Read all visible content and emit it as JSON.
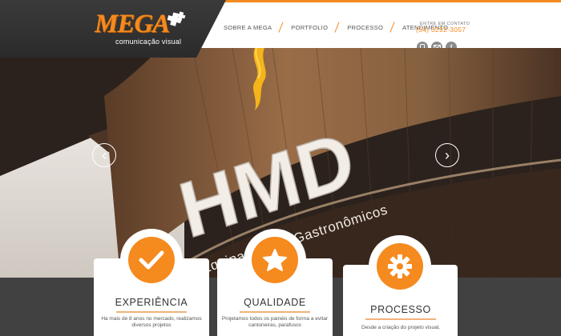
{
  "brand": {
    "name": "MEGA",
    "tagline": "comunicação visual",
    "accent": "#f58a1f",
    "dark": "#2f2f2f"
  },
  "nav": {
    "items": [
      {
        "label": "SOBRE A MEGA"
      },
      {
        "label": "PORTFOLIO"
      },
      {
        "label": "PROCESSO"
      },
      {
        "label": "ATENDIMENTO"
      }
    ]
  },
  "contact": {
    "label": "ENTRE EM CONTATO",
    "phone": "(54) 3292-3057",
    "social": [
      {
        "icon": "mobile-icon"
      },
      {
        "icon": "email-icon"
      },
      {
        "icon": "facebook-icon",
        "glyph": "f"
      }
    ]
  },
  "hero": {
    "sign_text": "HMD",
    "sign_subtext": "Equipamentos Gastronômicos",
    "prev_glyph": "‹",
    "next_glyph": "›"
  },
  "features": [
    {
      "icon": "checkmark-icon",
      "title": "EXPERIÊNCIA",
      "text": "Ha mais de 8 anos no mercado, realizamos diversos projetos"
    },
    {
      "icon": "star-icon",
      "title": "QUALIDADE",
      "text": "Projetamos todos os painéis de forma a evitar cantoneiras, parafusos"
    },
    {
      "icon": "gear-icon",
      "title": "PROCESSO",
      "text": "Desde a criação do projeto visual,"
    }
  ]
}
